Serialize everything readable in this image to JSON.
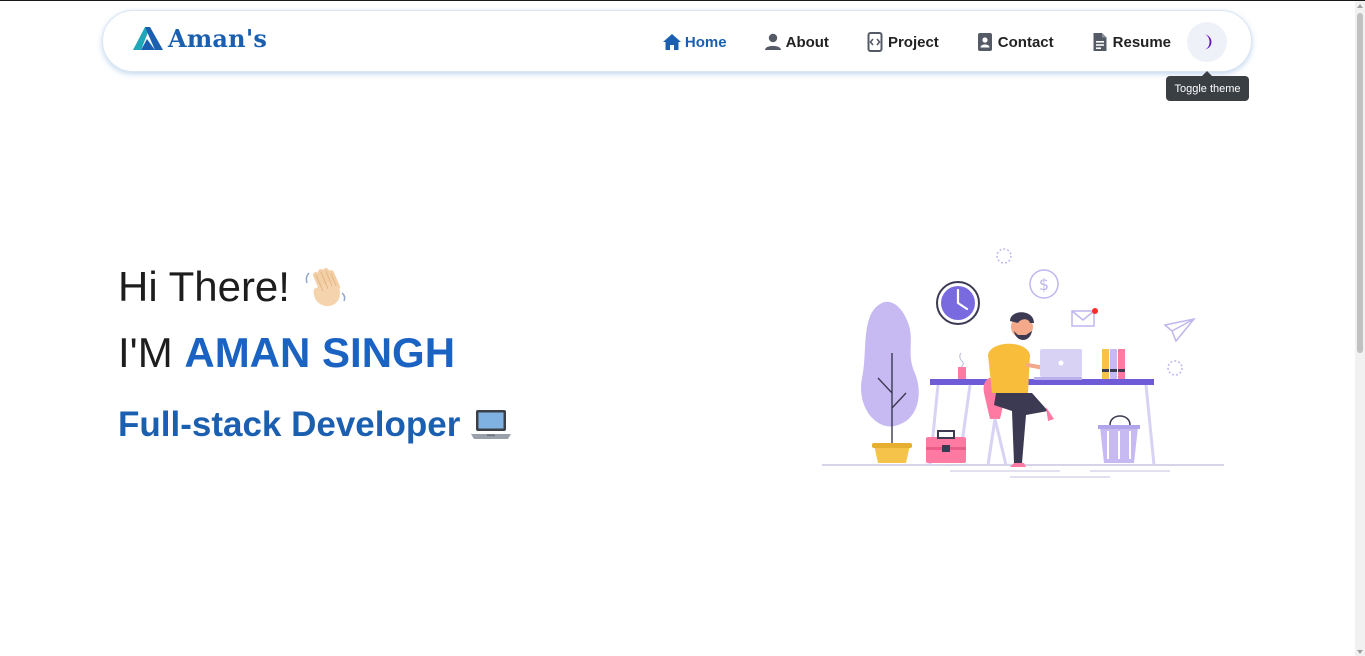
{
  "brand": {
    "logo_text": "Aman's",
    "colors": {
      "primary": "#1b5fb0",
      "accent": "#1b63c2",
      "toggle_moon": "#6a1fb8"
    }
  },
  "nav": {
    "items": [
      {
        "label": "Home",
        "icon": "home-icon",
        "active": true
      },
      {
        "label": "About",
        "icon": "user-icon",
        "active": false
      },
      {
        "label": "Project",
        "icon": "code-icon",
        "active": false
      },
      {
        "label": "Contact",
        "icon": "contact-icon",
        "active": false
      },
      {
        "label": "Resume",
        "icon": "document-icon",
        "active": false
      }
    ],
    "theme_toggle_icon": "moon-icon",
    "tooltip": "Toggle theme"
  },
  "hero": {
    "greeting": "Hi There!",
    "greeting_emoji": "waving-hand-icon",
    "intro_prefix": "I'M",
    "name": "AMAN SINGH",
    "role": "Full-stack Developer",
    "role_emoji": "laptop-icon"
  },
  "illustration": {
    "subject": "developer-at-desk-illustration"
  }
}
